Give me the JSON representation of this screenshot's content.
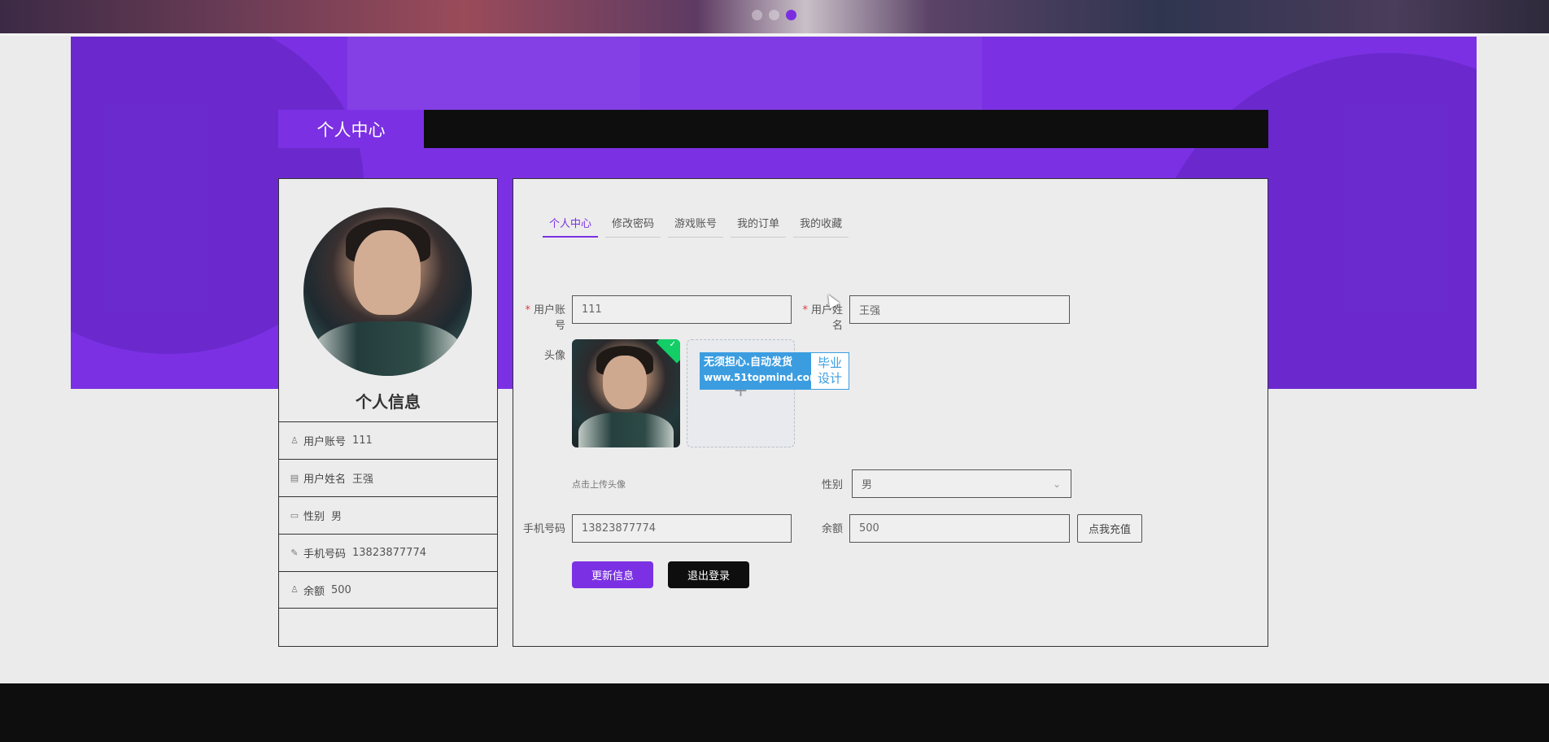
{
  "page": {
    "section_title": "个人中心"
  },
  "left_panel": {
    "title": "个人信息",
    "rows": [
      {
        "icon": "user-icon",
        "label": "用户账号",
        "value": "111"
      },
      {
        "icon": "id-card-icon",
        "label": "用户姓名",
        "value": "王强"
      },
      {
        "icon": "chat-icon",
        "label": "性别",
        "value": "男"
      },
      {
        "icon": "edit-icon",
        "label": "手机号码",
        "value": "13823877774"
      },
      {
        "icon": "user-icon",
        "label": "余额",
        "value": "500"
      }
    ]
  },
  "tabs": [
    "个人中心",
    "修改密码",
    "游戏账号",
    "我的订单",
    "我的收藏"
  ],
  "form": {
    "account_label": "用户账号",
    "account_value": "111",
    "name_label": "用户姓名",
    "name_value": "王强",
    "avatar_label": "头像",
    "avatar_hint": "点击上传头像",
    "gender_label": "性别",
    "gender_value": "男",
    "phone_label": "手机号码",
    "phone_value": "13823877774",
    "balance_label": "余额",
    "balance_value": "500",
    "recharge_label": "点我充值",
    "update_label": "更新信息",
    "logout_label": "退出登录"
  },
  "watermark": {
    "line1": "无须担心.自动发货",
    "line2": "www.51topmind.com",
    "side1": "毕业",
    "side2": "设计"
  },
  "colors": {
    "accent": "#7b31e3",
    "dark": "#0e0e0e",
    "required": "#e4393c"
  }
}
